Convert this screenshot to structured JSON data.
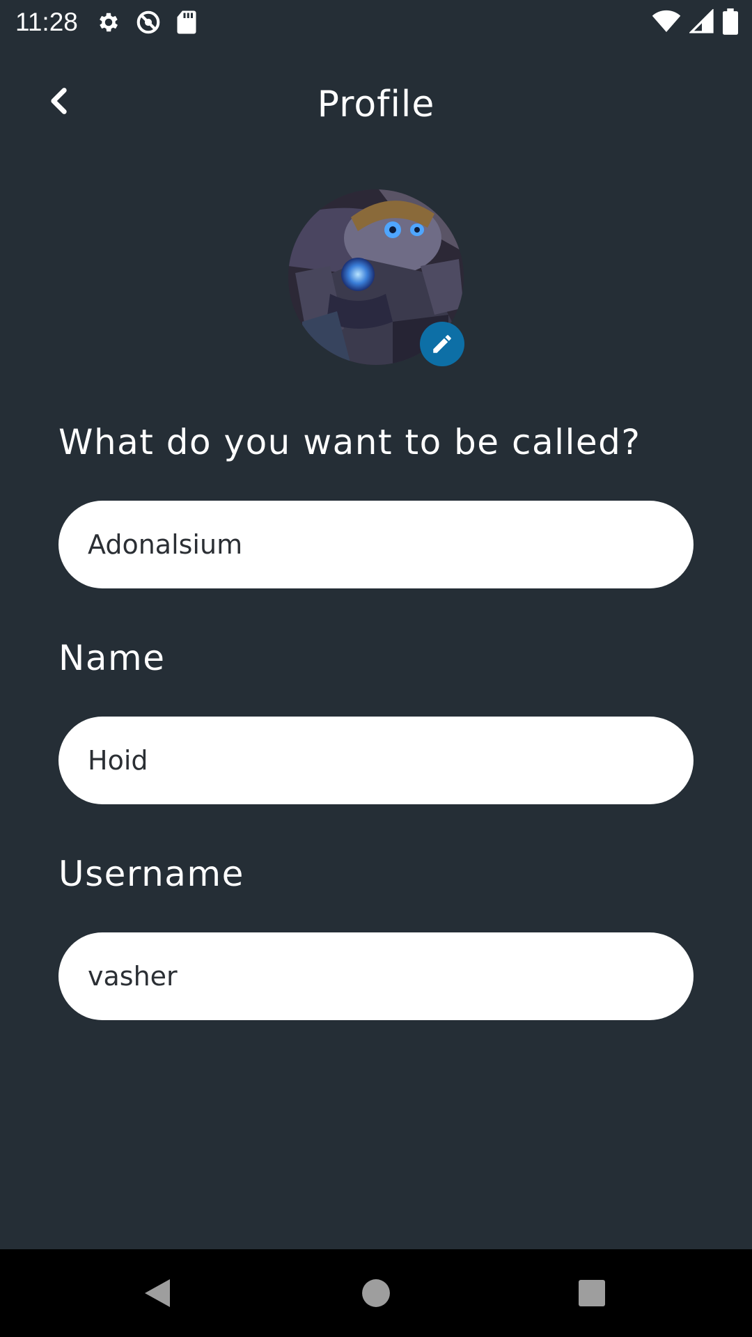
{
  "status_bar": {
    "time": "11:28",
    "icons": [
      "settings-icon",
      "do-not-disturb-icon",
      "sd-card-icon",
      "wifi-icon",
      "signal-icon",
      "battery-icon"
    ]
  },
  "header": {
    "title": "Profile",
    "back_icon": "chevron-left-icon"
  },
  "avatar": {
    "edit_icon": "pencil-icon",
    "edit_color": "#0d6fa6"
  },
  "form": {
    "nickname_label": "What do you want to be called?",
    "nickname_value": "Adonalsium",
    "name_label": "Name",
    "name_value": "Hoid",
    "username_label": "Username",
    "username_value": "vasher"
  },
  "nav_bar": {
    "icons": [
      "back-triangle-icon",
      "home-circle-icon",
      "recents-square-icon"
    ]
  },
  "colors": {
    "background": "#252e36",
    "input_background": "#ffffff",
    "accent": "#0d6fa6"
  }
}
